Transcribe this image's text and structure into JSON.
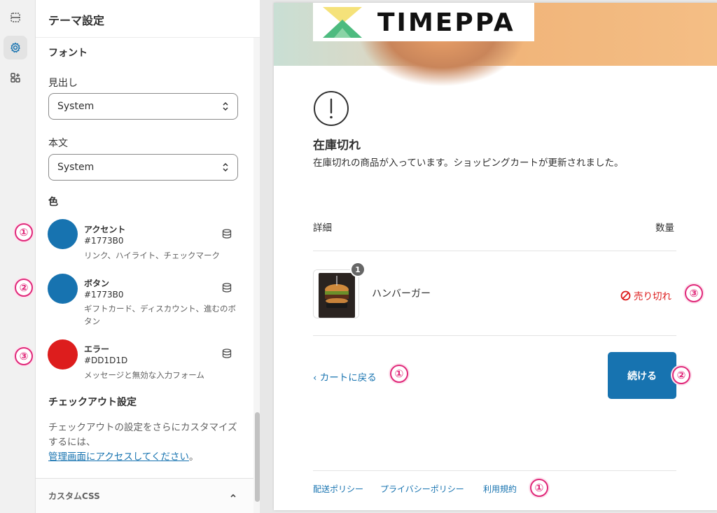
{
  "sidebar": {
    "title": "テーマ設定",
    "font_section": "フォント",
    "heading_label": "見出し",
    "heading_value": "System",
    "body_label": "本文",
    "body_value": "System",
    "color_section": "色",
    "colors": [
      {
        "name": "アクセント",
        "hex": "#1773B0",
        "desc": "リンク、ハイライト、チェックマーク",
        "swatch": "#1773B0",
        "marker": "①"
      },
      {
        "name": "ボタン",
        "hex": "#1773B0",
        "desc": "ギフトカード、ディスカウント、進むのボタン",
        "swatch": "#1773B0",
        "marker": "②"
      },
      {
        "name": "エラー",
        "hex": "#DD1D1D",
        "desc": "メッセージと無効な入力フォーム",
        "swatch": "#DD1D1D",
        "marker": "③"
      }
    ],
    "checkout_section": "チェックアウト設定",
    "checkout_desc": "チェックアウトの設定をさらにカスタマイズするには、",
    "checkout_link": "管理画面にアクセスしてください",
    "checkout_period": "。",
    "custom_css": "カスタムCSS"
  },
  "preview": {
    "logo": "TIMEPPA",
    "oos_title": "在庫切れ",
    "oos_message": "在庫切れの商品が入っています。ショッピングカートが更新されました。",
    "col_detail": "詳細",
    "col_qty": "数量",
    "item": {
      "name": "ハンバーガー",
      "qty": "1",
      "status": "売り切れ",
      "marker": "③"
    },
    "back_link": "カートに戻る",
    "back_marker": "①",
    "continue": "続ける",
    "continue_marker": "②",
    "footer_links": [
      "配送ポリシー",
      "プライバシーポリシー",
      "利用規約"
    ],
    "footer_marker": "①"
  },
  "colors": {
    "accent": "#1773B0",
    "error": "#DD1D1D",
    "annotation": "#E0297A"
  }
}
